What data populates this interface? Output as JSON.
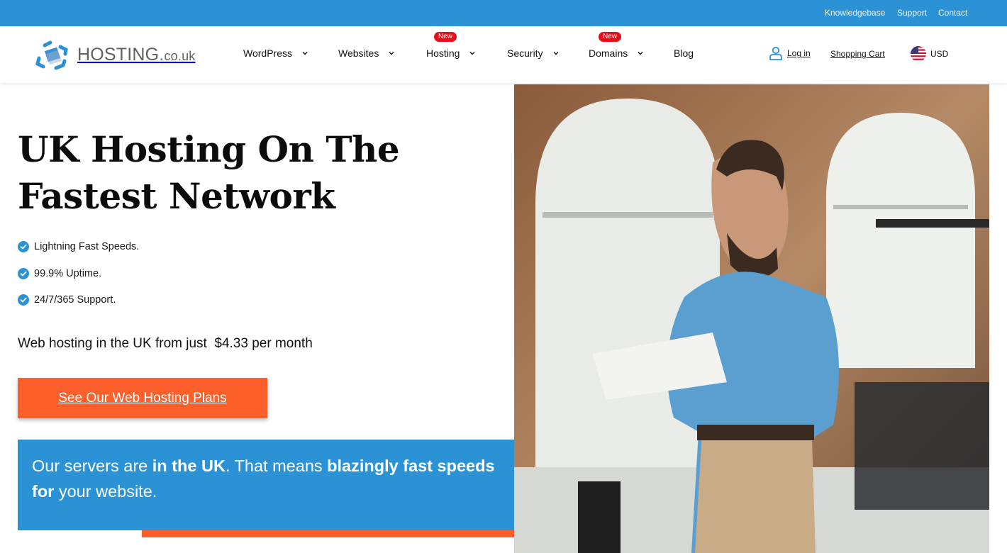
{
  "topbar": {
    "links": [
      {
        "label": "Knowledgebase"
      },
      {
        "label": "Support"
      },
      {
        "label": "Contact"
      }
    ]
  },
  "header": {
    "logo": {
      "main": "HOSTING",
      "dot": ".",
      "tld1": "co",
      "dot2": ".",
      "tld2": "uk"
    },
    "nav": [
      {
        "label": "WordPress",
        "dropdown": true,
        "badge": null
      },
      {
        "label": "Websites",
        "dropdown": true,
        "badge": null
      },
      {
        "label": "Hosting",
        "dropdown": true,
        "badge": "New"
      },
      {
        "label": "Security",
        "dropdown": true,
        "badge": null
      },
      {
        "label": "Domains",
        "dropdown": true,
        "badge": "New"
      },
      {
        "label": "Blog",
        "dropdown": false,
        "badge": null
      }
    ],
    "login_label": "Log in",
    "cart_label": "Shopping Cart",
    "currency_label": "USD",
    "currency_icon": "us-flag-icon"
  },
  "hero": {
    "title_line1": "UK Hosting On The",
    "title_line2": "Fastest Network",
    "features": [
      "Lightning Fast Speeds.",
      "99.9% Uptime.",
      "24/7/365 Support."
    ],
    "price_prefix": "Web hosting in the UK from just",
    "price_value": "$4.33",
    "price_suffix": "per month",
    "cta_label": "See Our Web Hosting Plans",
    "info": {
      "part1": "Our servers are ",
      "bold1": "in the UK",
      "part2": ". That means ",
      "bold2": "blazingly fast speeds for",
      "part3": " your website."
    },
    "image_alt": "Man in blue shirt reading a document in an office"
  },
  "colors": {
    "brand_blue": "#2b93d5",
    "cta_orange": "#fd5f2a",
    "badge_red": "#e3101a"
  }
}
